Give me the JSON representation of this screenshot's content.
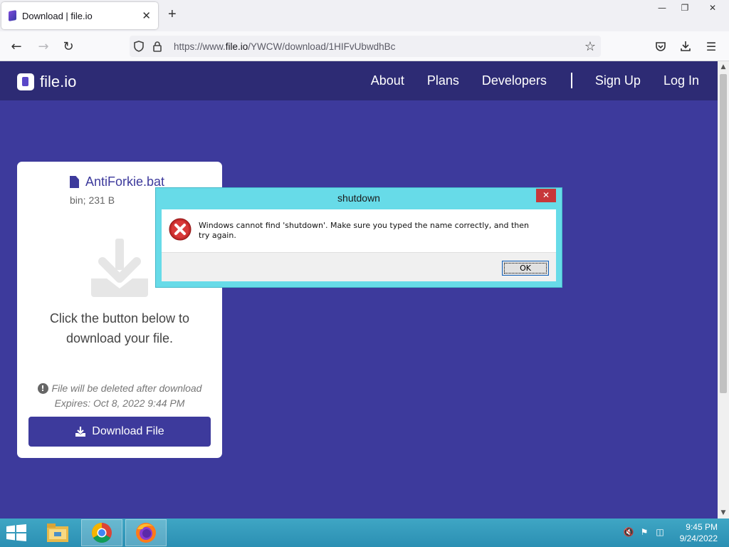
{
  "browser": {
    "tab_title": "Download | file.io",
    "tab_close": "✕",
    "new_tab": "+",
    "url_scheme": "https://www.",
    "url_host": "file.io",
    "url_path": "/YWCW/download/1HIFvUbwdhBc",
    "window_controls": {
      "minimize": "—",
      "restore": "❐",
      "close": "✕"
    }
  },
  "site": {
    "logo_text": "file.io",
    "nav": [
      "About",
      "Plans",
      "Developers",
      "Sign Up",
      "Log In"
    ]
  },
  "card": {
    "file_name": "AntiForkie.bat",
    "file_meta": "bin; 231 B",
    "message_line1": "Click the button below to",
    "message_line2": "download your file.",
    "warning": "File will be deleted after download",
    "expires": "Expires: Oct 8, 2022 9:44 PM",
    "download_button": "Download File"
  },
  "dialog": {
    "title": "shutdown",
    "message": "Windows cannot find 'shutdown'. Make sure you typed the name correctly, and then try again.",
    "ok_label": "OK",
    "close_glyph": "✕"
  },
  "taskbar": {
    "items": [
      "file-explorer",
      "chrome",
      "firefox"
    ],
    "time": "9:45 PM",
    "date": "9/24/2022"
  },
  "colors": {
    "page_bg": "#3d3a9c",
    "header_bg": "#2d2b74",
    "dialog_frame": "#67dbe8",
    "dialog_close": "#c7373a",
    "taskbar": "#2b8fb3"
  }
}
